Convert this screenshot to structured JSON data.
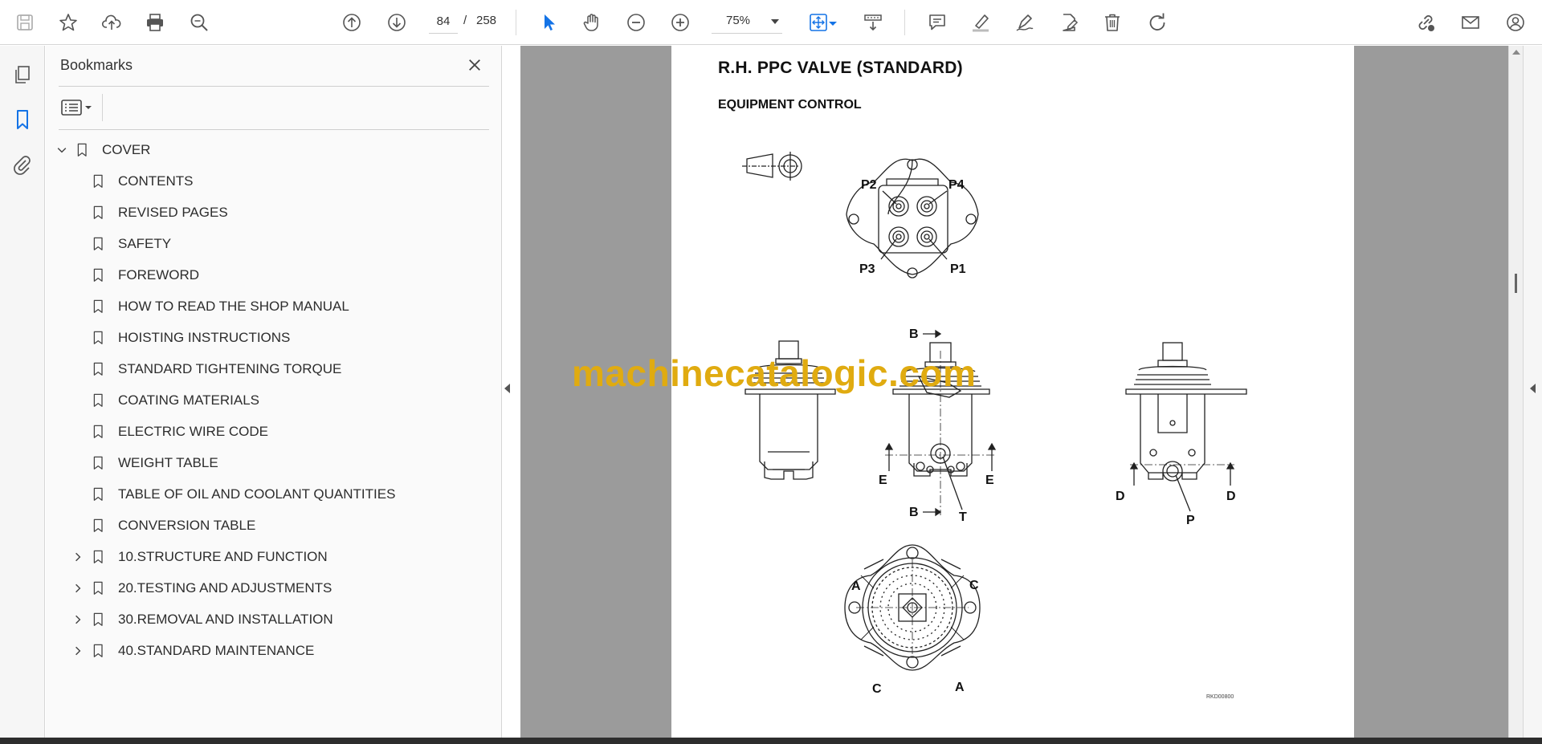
{
  "toolbar": {
    "current_page": "84",
    "page_separator": "/",
    "total_pages": "258",
    "zoom": "75%"
  },
  "bookmarks": {
    "title": "Bookmarks",
    "items": [
      {
        "label": "COVER",
        "level": 0,
        "expander": "expanded"
      },
      {
        "label": "CONTENTS",
        "level": 1,
        "expander": "none"
      },
      {
        "label": "REVISED PAGES",
        "level": 1,
        "expander": "none"
      },
      {
        "label": "SAFETY",
        "level": 1,
        "expander": "none"
      },
      {
        "label": "FOREWORD",
        "level": 1,
        "expander": "none"
      },
      {
        "label": "HOW TO READ THE SHOP MANUAL",
        "level": 1,
        "expander": "none"
      },
      {
        "label": "HOISTING INSTRUCTIONS",
        "level": 1,
        "expander": "none"
      },
      {
        "label": "STANDARD TIGHTENING TORQUE",
        "level": 1,
        "expander": "none"
      },
      {
        "label": "COATING MATERIALS",
        "level": 1,
        "expander": "none"
      },
      {
        "label": "ELECTRIC WIRE CODE",
        "level": 1,
        "expander": "none"
      },
      {
        "label": "WEIGHT TABLE",
        "level": 1,
        "expander": "none"
      },
      {
        "label": "TABLE OF OIL AND COOLANT QUANTITIES",
        "level": 1,
        "expander": "none"
      },
      {
        "label": "CONVERSION TABLE",
        "level": 1,
        "expander": "none"
      },
      {
        "label": "10.STRUCTURE AND FUNCTION",
        "level": 1,
        "expander": "collapsed"
      },
      {
        "label": "20.TESTING AND ADJUSTMENTS",
        "level": 1,
        "expander": "collapsed"
      },
      {
        "label": "30.REMOVAL AND INSTALLATION",
        "level": 1,
        "expander": "collapsed"
      },
      {
        "label": "40.STANDARD MAINTENANCE",
        "level": 1,
        "expander": "collapsed"
      }
    ]
  },
  "document": {
    "title": "R.H. PPC VALVE (STANDARD)",
    "subtitle": "EQUIPMENT CONTROL",
    "watermark": "machinecatalogic.com",
    "figure_code": "RKD00800",
    "labels": {
      "p1": "P1",
      "p2": "P2",
      "p3": "P3",
      "p4": "P4",
      "b_top": "B",
      "b_bottom": "B",
      "e_left": "E",
      "e_right": "E",
      "t": "T",
      "d_left": "D",
      "d_right": "D",
      "p": "P",
      "a_top": "A",
      "a_bottom": "A",
      "c_top": "C",
      "c_bottom": "C"
    }
  },
  "colors": {
    "accent": "#1473e6",
    "watermark": "#e0ab10",
    "doc_background": "#9b9b9b",
    "icon": "#555555"
  },
  "icons": {
    "save": "save-icon",
    "bookmark": "star-icon",
    "upload": "upload-icon",
    "print": "print-icon",
    "find": "search-icon",
    "prev_page": "arrow-up-circle-icon",
    "next_page": "arrow-down-circle-icon",
    "zoom_out": "minus-circle-icon",
    "zoom_in": "plus-circle-icon",
    "select": "cursor-icon",
    "hand": "hand-icon",
    "fit": "fit-page-icon",
    "scroll": "scroll-mode-icon",
    "comment": "comment-icon",
    "highlight": "highlighter-icon",
    "draw": "pen-icon",
    "fill_sign": "fill-sign-icon",
    "delete": "trash-icon",
    "rotate": "rotate-icon",
    "link": "link-icon",
    "email": "mail-icon",
    "account": "user-icon"
  }
}
